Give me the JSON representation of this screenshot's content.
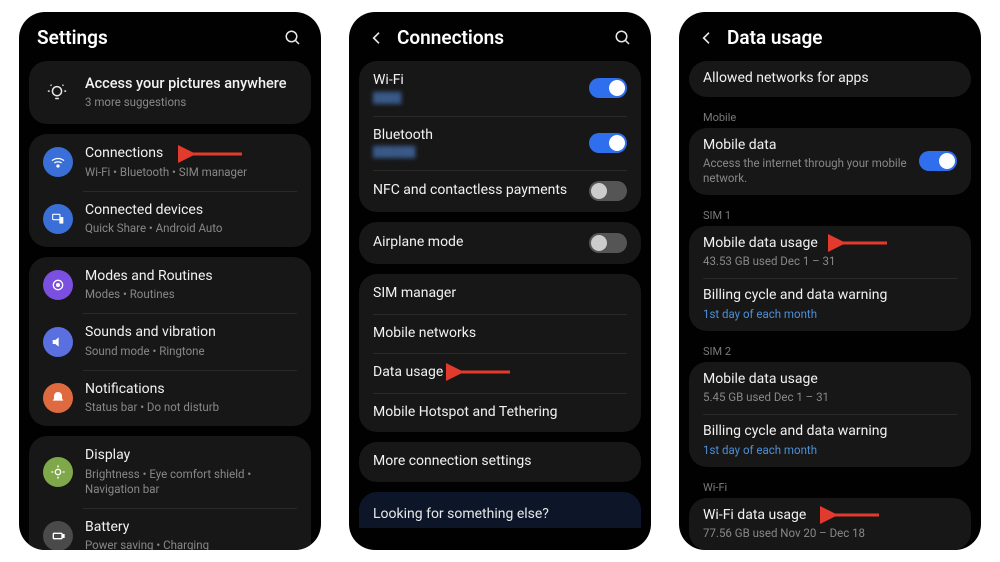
{
  "settings": {
    "title": "Settings",
    "suggestion": {
      "title": "Access your pictures anywhere",
      "sub": "3 more suggestions"
    },
    "g1": [
      {
        "label": "Connections",
        "sub": "Wi-Fi • Bluetooth • SIM manager",
        "icon": "wifi",
        "color": "#3a6fd8"
      },
      {
        "label": "Connected devices",
        "sub": "Quick Share • Android Auto",
        "icon": "devices",
        "color": "#3a6fd8"
      }
    ],
    "g2": [
      {
        "label": "Modes and Routines",
        "sub": "Modes • Routines",
        "icon": "routines",
        "color": "#7b4fe0"
      },
      {
        "label": "Sounds and vibration",
        "sub": "Sound mode • Ringtone",
        "icon": "sound",
        "color": "#5a6fe0"
      },
      {
        "label": "Notifications",
        "sub": "Status bar • Do not disturb",
        "icon": "notif",
        "color": "#e06a3f"
      }
    ],
    "g3": [
      {
        "label": "Display",
        "sub": "Brightness • Eye comfort shield • Navigation bar",
        "icon": "display",
        "color": "#7fa84a"
      },
      {
        "label": "Battery",
        "sub": "Power saving • Charging",
        "icon": "battery",
        "color": "#4a4a4a"
      }
    ]
  },
  "connections": {
    "title": "Connections",
    "g1": [
      {
        "label": "Wi-Fi",
        "toggle": "on",
        "blur": "network"
      },
      {
        "label": "Bluetooth",
        "toggle": "on",
        "blur": "device"
      },
      {
        "label": "NFC and contactless payments",
        "toggle": "off"
      }
    ],
    "g2": [
      {
        "label": "Airplane mode",
        "toggle": "off"
      }
    ],
    "g3": [
      {
        "label": "SIM manager"
      },
      {
        "label": "Mobile networks"
      },
      {
        "label": "Data usage"
      },
      {
        "label": "Mobile Hotspot and Tethering"
      }
    ],
    "g4": [
      {
        "label": "More connection settings"
      }
    ],
    "hint": "Looking for something else?"
  },
  "datausage": {
    "title": "Data usage",
    "allowed": {
      "label": "Allowed networks for apps"
    },
    "sections": [
      {
        "header": "Mobile",
        "rows": [
          {
            "label": "Mobile data",
            "sub": "Access the internet through your mobile network.",
            "toggle": "on"
          }
        ]
      },
      {
        "header": "SIM 1",
        "rows": [
          {
            "label": "Mobile data usage",
            "sub": "43.53 GB used Dec 1 – 31"
          },
          {
            "label": "Billing cycle and data warning",
            "sub": "1st day of each month",
            "link": true
          }
        ]
      },
      {
        "header": "SIM 2",
        "rows": [
          {
            "label": "Mobile data usage",
            "sub": "5.45 GB used Dec 1 – 31"
          },
          {
            "label": "Billing cycle and data warning",
            "sub": "1st day of each month",
            "link": true
          }
        ]
      },
      {
        "header": "Wi-Fi",
        "rows": [
          {
            "label": "Wi-Fi data usage",
            "sub": "77.56 GB used Nov 20 – Dec 18"
          }
        ]
      }
    ]
  },
  "arrows": {
    "color": "#e23b2e"
  }
}
